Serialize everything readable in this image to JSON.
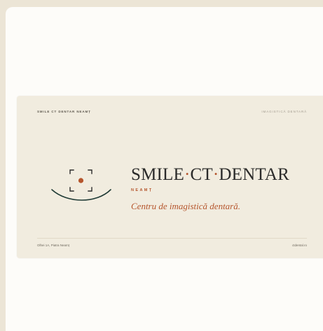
{
  "card": {
    "header_left": "SMILE CT DENTAR NEAMȚ",
    "header_right": "IMAGISTICĂ DENTARĂ",
    "brand": {
      "part1": "SMILE",
      "sep1": "·",
      "part2": "CT",
      "sep2": "·",
      "part3": "DENTAR",
      "subtitle": "NEAMȚ",
      "tagline": "Centru de imagistică dentară."
    },
    "footer_left": "Olhei 1A, Piatra Neamț",
    "footer_right": "ctdental.ro"
  },
  "colors": {
    "accent": "#b5552c",
    "ink": "#2b2b2a",
    "card_bg": "#f1ecdf",
    "page_bg": "#ece5d6"
  },
  "icons": {
    "logo": "scan-frame-smile-icon"
  }
}
